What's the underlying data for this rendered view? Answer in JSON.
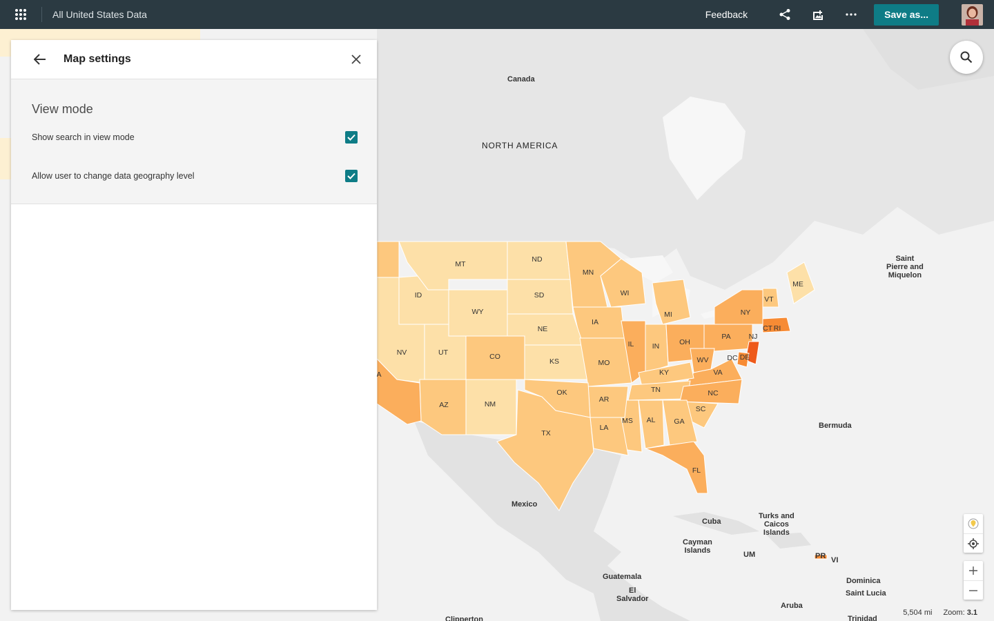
{
  "topbar": {
    "title": "All United States Data",
    "feedback": "Feedback",
    "save_as": "Save as..."
  },
  "panel": {
    "title": "Map settings",
    "section_title": "View mode",
    "settings": [
      {
        "label": "Show search in view mode",
        "checked": true
      },
      {
        "label": "Allow user to change data geography level",
        "checked": true
      }
    ]
  },
  "map_labels": {
    "canada": "Canada",
    "north_america": "NORTH AMERICA",
    "saint_pierre": "Saint\nPierre and\nMiquelon",
    "bermuda": "Bermuda",
    "mexico": "Mexico",
    "cuba": "Cuba",
    "turks": "Turks and\nCaicos\nIslands",
    "cayman": "Cayman\nIslands",
    "um": "UM",
    "pr": "PR",
    "vi": "VI",
    "guatemala": "Guatemala",
    "el_salvador": "El\nSalvador",
    "dominica": "Dominica",
    "saint_lucia": "Saint Lucia",
    "aruba": "Aruba",
    "trinidad": "Trinidad",
    "clipperton": "Clipperton"
  },
  "states": [
    {
      "abbr": "MT"
    },
    {
      "abbr": "ND"
    },
    {
      "abbr": "MN"
    },
    {
      "abbr": "ID"
    },
    {
      "abbr": "SD"
    },
    {
      "abbr": "WI"
    },
    {
      "abbr": "WY"
    },
    {
      "abbr": "IA"
    },
    {
      "abbr": "MI"
    },
    {
      "abbr": "NE"
    },
    {
      "abbr": "NV"
    },
    {
      "abbr": "UT"
    },
    {
      "abbr": "CO"
    },
    {
      "abbr": "KS"
    },
    {
      "abbr": "MO"
    },
    {
      "abbr": "IL"
    },
    {
      "abbr": "IN"
    },
    {
      "abbr": "OH"
    },
    {
      "abbr": "PA"
    },
    {
      "abbr": "NY"
    },
    {
      "abbr": "VT"
    },
    {
      "abbr": "ME"
    },
    {
      "abbr": "CT"
    },
    {
      "abbr": "RI"
    },
    {
      "abbr": "NJ"
    },
    {
      "abbr": "DE"
    },
    {
      "abbr": "DC"
    },
    {
      "abbr": "WV"
    },
    {
      "abbr": "VA"
    },
    {
      "abbr": "KY"
    },
    {
      "abbr": "TN"
    },
    {
      "abbr": "NC"
    },
    {
      "abbr": "SC"
    },
    {
      "abbr": "GA"
    },
    {
      "abbr": "AL"
    },
    {
      "abbr": "MS"
    },
    {
      "abbr": "LA"
    },
    {
      "abbr": "AR"
    },
    {
      "abbr": "OK"
    },
    {
      "abbr": "TX"
    },
    {
      "abbr": "NM"
    },
    {
      "abbr": "AZ"
    },
    {
      "abbr": "FL"
    },
    {
      "abbr": "A"
    }
  ],
  "status": {
    "scale": "5,504 mi",
    "zoom_label": "Zoom:",
    "zoom_value": "3.1"
  },
  "colors": {
    "topbar": "#2b3a42",
    "accent": "#0e7c86",
    "choropleth": [
      "#fde0a8",
      "#fdc87e",
      "#fbae5c",
      "#f78b34",
      "#ee5a1a"
    ]
  }
}
